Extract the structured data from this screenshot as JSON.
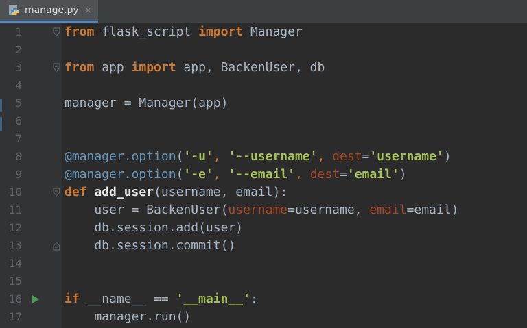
{
  "tab": {
    "filename": "manage.py",
    "close_glyph": "×",
    "icon": "python-file-icon"
  },
  "colors": {
    "keyword": "#cc7832",
    "string": "#6a8759",
    "decorator": "#6897bb",
    "param": "#aa4926",
    "text": "#a9b7c6",
    "accent": "#4a88c7"
  },
  "lines": [
    {
      "n": "1"
    },
    {
      "n": "2"
    },
    {
      "n": "3"
    },
    {
      "n": "4"
    },
    {
      "n": "5"
    },
    {
      "n": "6"
    },
    {
      "n": "7"
    },
    {
      "n": "8"
    },
    {
      "n": "9"
    },
    {
      "n": "10"
    },
    {
      "n": "11"
    },
    {
      "n": "12"
    },
    {
      "n": "13"
    },
    {
      "n": "14"
    },
    {
      "n": "15"
    },
    {
      "n": "16"
    },
    {
      "n": "17"
    }
  ],
  "code": {
    "l1": [
      "from",
      " flask_script ",
      "import",
      " Manager"
    ],
    "l3": [
      "from",
      " app ",
      "import",
      " app, BackenUser, db"
    ],
    "l5": [
      "manager = Manager(app)"
    ],
    "l8": [
      "@manager.option",
      "(",
      "'-u'",
      ", ",
      "'--username'",
      ", ",
      "dest",
      "=",
      "'username'",
      ")"
    ],
    "l9": [
      "@manager.option",
      "(",
      "'-e'",
      ", ",
      "'--email'",
      ", ",
      "dest",
      "=",
      "'email'",
      ")"
    ],
    "l10": [
      "def",
      " ",
      "add_user",
      "(username, email):"
    ],
    "l11": [
      "    user = BackenUser(",
      "username",
      "=username, ",
      "email",
      "=email)"
    ],
    "l12": [
      "    db.session.add(user)"
    ],
    "l13": [
      "    db.session.commit()"
    ],
    "l16": [
      "if",
      " __name__ == ",
      "'__main__'",
      ":"
    ],
    "l17": [
      "    manager.run()"
    ]
  }
}
